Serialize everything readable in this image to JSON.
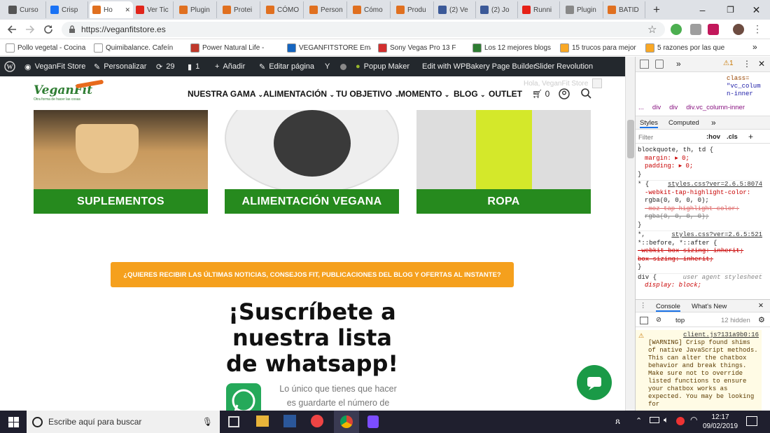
{
  "browser": {
    "tabs": [
      {
        "label": "Curso",
        "icon": "b-circle-icon",
        "color": "#555"
      },
      {
        "label": "Crisp",
        "icon": "crisp-icon",
        "color": "#1972f5"
      },
      {
        "label": "Ho",
        "icon": "veganfit-icon",
        "color": "#e07020",
        "active": true
      },
      {
        "label": "Ver Tic",
        "icon": "w-icon",
        "color": "#e1251b"
      },
      {
        "label": "Plugin",
        "icon": "veganfit-icon",
        "color": "#e07020"
      },
      {
        "label": "Protei",
        "icon": "veganfit-icon",
        "color": "#e07020"
      },
      {
        "label": "CÓMO",
        "icon": "veganfit-icon",
        "color": "#e07020"
      },
      {
        "label": "Person",
        "icon": "veganfit-icon",
        "color": "#e07020"
      },
      {
        "label": "Cómo",
        "icon": "veganfit-icon",
        "color": "#e07020"
      },
      {
        "label": "Produ",
        "icon": "veganfit-icon",
        "color": "#e07020"
      },
      {
        "label": "(2) Ve",
        "icon": "facebook-icon",
        "color": "#3b5998"
      },
      {
        "label": "(2) Jo",
        "icon": "facebook-icon",
        "color": "#3b5998"
      },
      {
        "label": "Runni",
        "icon": "youtube-icon",
        "color": "#e62117"
      },
      {
        "label": "Plugin",
        "icon": "page-icon",
        "color": "#888"
      },
      {
        "label": "BATID",
        "icon": "veganfit-icon",
        "color": "#e07020"
      }
    ],
    "new_tab": "+",
    "window_controls": {
      "minimize": "–",
      "maximize": "❐",
      "close": "✕"
    },
    "url": "https://veganfitstore.es",
    "bookmarks": [
      {
        "label": "Pollo vegetal - Cocina",
        "color": "#ffffff"
      },
      {
        "label": "Quimibalance. Cafeín",
        "color": "#ffffff"
      },
      {
        "label": "Power Natural Life - ",
        "color": "#c0392b"
      },
      {
        "label": "VEGANFITSTORE Ema",
        "color": "#1565c0"
      },
      {
        "label": "Sony Vegas Pro 13 F",
        "color": "#d32f2f"
      },
      {
        "label": "Los 12 mejores blogs",
        "color": "#2e7d32"
      },
      {
        "label": "15 trucos para mejor",
        "color": "#f9a825"
      },
      {
        "label": "5 razones por las que",
        "color": "#f9a825"
      }
    ],
    "bookmarks_more": "»"
  },
  "wp_admin_bar": {
    "items": [
      "VeganFit Store",
      "Personalizar",
      "29",
      "1",
      "Añadir",
      "Editar página",
      "Popup Maker",
      "Edit with WPBakery Page Builder",
      "Slider Revolution"
    ]
  },
  "site": {
    "logo_text": "VeganFit",
    "logo_tagline": "Otra forma de hacer las cosas",
    "nav": [
      "NUESTRA GAMA",
      "ALIMENTACIÓN",
      "TU OBJETIVO",
      "MOMENTO",
      "BLOG",
      "OUTLET"
    ],
    "cart_count": "0",
    "ghost_text": "Hola, VeganFit Store",
    "categories": [
      "SUPLEMENTOS",
      "ALIMENTACIÓN VEGANA",
      "ROPA"
    ],
    "newsletter_button": "¿QUIERES RECIBIR LAS ÚLTIMAS NOTICIAS, CONSEJOS FIT, PUBLICACIONES DEL BLOG Y OFERTAS AL INSTANTE?",
    "subscribe_title": [
      "¡Suscríbete a",
      "nuestra lista",
      "de whatsapp!"
    ],
    "subscribe_text": [
      "Lo único que tienes que hacer",
      "es guardarte el número de"
    ]
  },
  "devtools": {
    "more_tab": "»",
    "warning_count": "1",
    "breadcrumb": [
      "...",
      "div",
      "div",
      "div.vc_column-inner"
    ],
    "element_snippet": [
      "class=",
      "\"vc_colum",
      "n-inner"
    ],
    "tabs": [
      "Styles",
      "Computed"
    ],
    "filter_placeholder": "Filter",
    "filter_options": [
      ":hov",
      ".cls",
      "+"
    ],
    "css_rules": [
      {
        "selector": "blockquote, th, td {",
        "lines": [
          "margin: ▸ 0;",
          "padding: ▸ 0;"
        ],
        "close": "}"
      },
      {
        "selector": "* {",
        "source": "styles.css?ver=2.6.5:8074",
        "lines": [
          "-webkit-tap-highlight-color:",
          "  rgba(0, 0, 0, 0);",
          "-moz-tap-highlight-color:",
          "  rgba(0, 0, 0, 0);"
        ],
        "close": "}"
      },
      {
        "selector": "*,",
        "source": "styles.css?ver=2.6.5:521",
        "lines": [
          "*::before, *::after {",
          "-webkit-box-sizing: inherit;",
          "box-sizing: inherit;"
        ],
        "close": "}"
      },
      {
        "selector": "div {",
        "source": "user agent stylesheet",
        "lines": [
          "display: block;"
        ],
        "close": ""
      }
    ],
    "console_tabs": [
      "Console",
      "What's New"
    ],
    "context": "top",
    "hidden": "12 hidden",
    "console_source": "client.js?131a9b0:16",
    "console_message": "[WARNING] Crisp found shims of native JavaScript methods. This can alter the chatbox behavior and break things. Make sure not to override listed functions to ensure your chatbox works as expected. You may be looking for"
  },
  "taskbar": {
    "search_placeholder": "Escribe aquí para buscar",
    "time": "12:17",
    "date": "09/02/2019"
  },
  "colors": {
    "green": "#268a1e",
    "orange": "#f5a01d",
    "wp_bar": "#23282d",
    "taskbar": "#1f1f2e"
  }
}
